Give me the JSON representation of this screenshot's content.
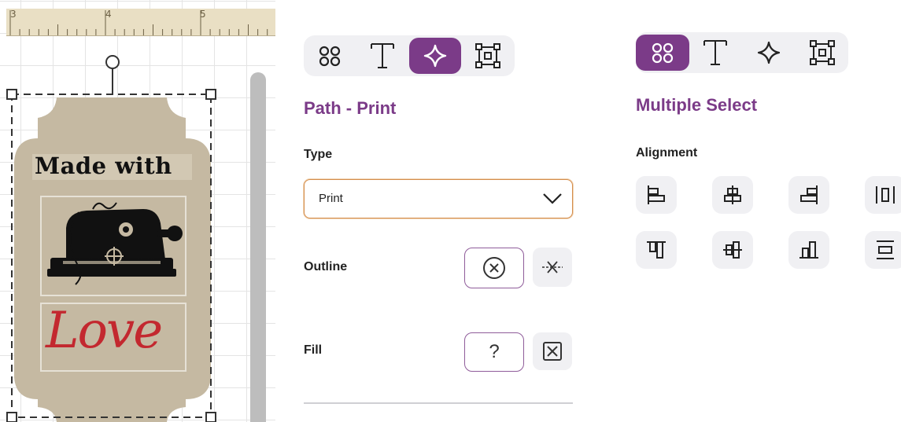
{
  "ruler": {
    "labels": [
      "3",
      "4",
      "5"
    ]
  },
  "canvas": {
    "tag_title": "Made with",
    "tag_script": "Love",
    "colors": {
      "tag": "#c5b9a2",
      "script": "#c3282f",
      "selection": "#333333"
    }
  },
  "path_panel": {
    "toolbar": [
      {
        "icon": "shapes-icon",
        "active": false
      },
      {
        "icon": "text-icon",
        "active": false
      },
      {
        "icon": "path-nodes-icon",
        "active": true
      },
      {
        "icon": "bounding-box-icon",
        "active": false
      }
    ],
    "title": "Path - Print",
    "type_label": "Type",
    "type_value": "Print",
    "outline_label": "Outline",
    "fill_label": "Fill",
    "fill_value": "?"
  },
  "multi_panel": {
    "toolbar": [
      {
        "icon": "shapes-icon",
        "active": true
      },
      {
        "icon": "text-icon",
        "active": false
      },
      {
        "icon": "path-nodes-icon",
        "active": false
      },
      {
        "icon": "bounding-box-icon",
        "active": false
      }
    ],
    "title": "Multiple Select",
    "alignment_label": "Alignment",
    "alignment_buttons": [
      "align-left-icon",
      "align-center-horizontal-icon",
      "align-right-icon",
      "distribute-horizontal-icon",
      "align-top-icon",
      "align-center-vertical-icon",
      "align-bottom-icon",
      "distribute-vertical-icon"
    ]
  },
  "theme": {
    "accent": "#7b3b88",
    "button_bg": "#f0f0f3",
    "select_border": "#d48d4c"
  }
}
